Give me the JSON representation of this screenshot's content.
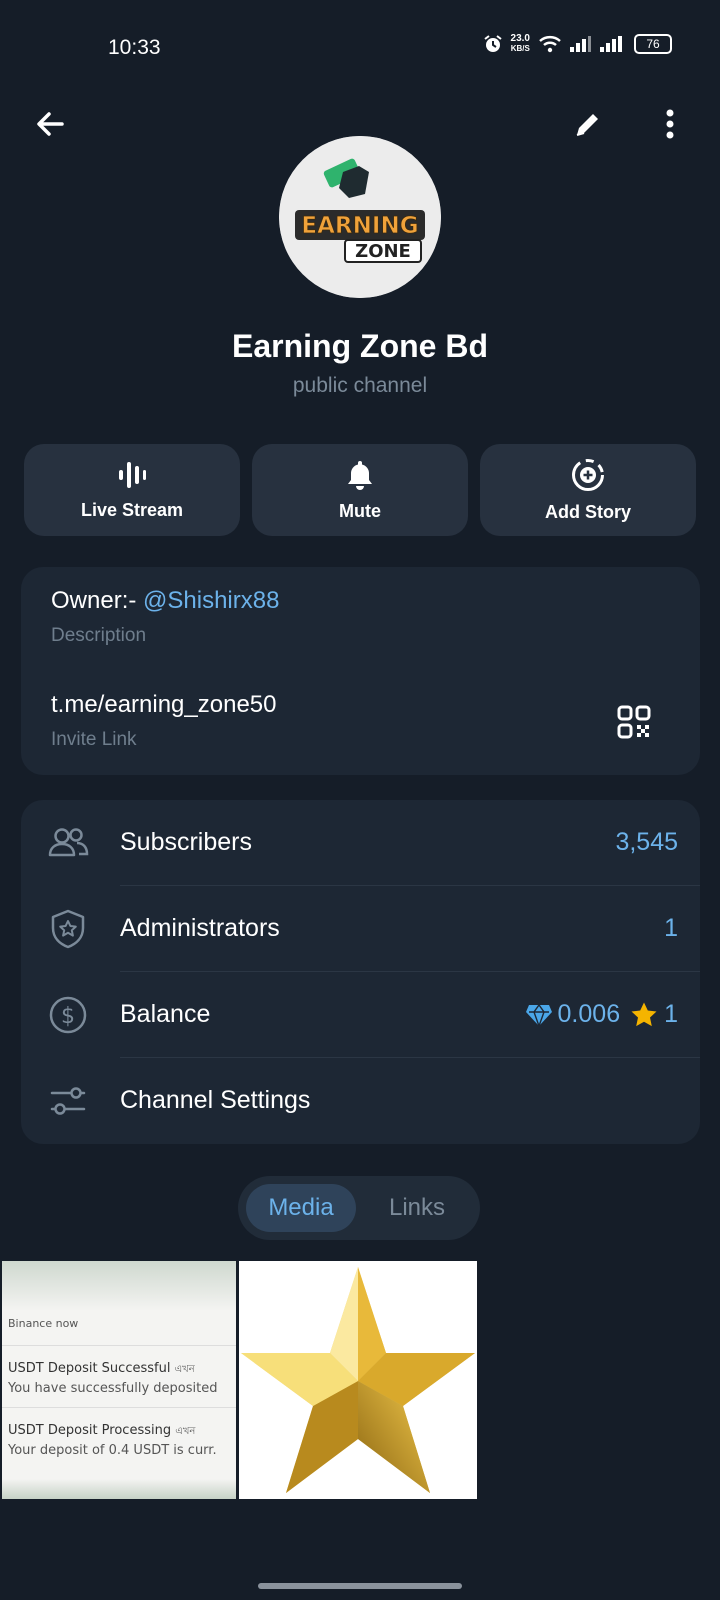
{
  "status_bar": {
    "time": "10:33",
    "net_speed_value": "23.0",
    "net_speed_unit": "KB/S",
    "battery": "76"
  },
  "icons": {
    "back": "arrow-left-icon",
    "edit": "pencil-icon",
    "more": "more-vertical-icon"
  },
  "channel": {
    "name": "Earning Zone Bd",
    "type": "public channel",
    "avatar_line1": "EARNING",
    "avatar_line2": "ZONE"
  },
  "actions": [
    {
      "label": "Live Stream",
      "icon": "live-stream-icon"
    },
    {
      "label": "Mute",
      "icon": "bell-icon"
    },
    {
      "label": "Add Story",
      "icon": "add-story-icon"
    }
  ],
  "info": {
    "description_prefix": "Owner:- ",
    "description_handle": "@Shishirx88",
    "description_label": "Description",
    "link": "t.me/earning_zone50",
    "link_label": "Invite Link"
  },
  "stats": {
    "subscribers_label": "Subscribers",
    "subscribers_value": "3,545",
    "admins_label": "Administrators",
    "admins_value": "1",
    "balance_label": "Balance",
    "balance_ton": "0.006",
    "balance_stars": "1",
    "settings_label": "Channel Settings"
  },
  "tabs": {
    "media": "Media",
    "links": "Links",
    "active": "Media"
  },
  "media": {
    "notif_app": "Binance  now",
    "notif1_title": "USDT Deposit Successful",
    "notif1_time": "এখন",
    "notif1_body": "You have successfully deposited",
    "notif2_title": "USDT Deposit Processing",
    "notif2_time": "এখন",
    "notif2_body": "Your deposit of 0.4 USDT is curr."
  },
  "colors": {
    "background": "#151d28",
    "card": "#1d2734",
    "accent": "#6cb2ea",
    "muted": "#6f7e8d"
  }
}
